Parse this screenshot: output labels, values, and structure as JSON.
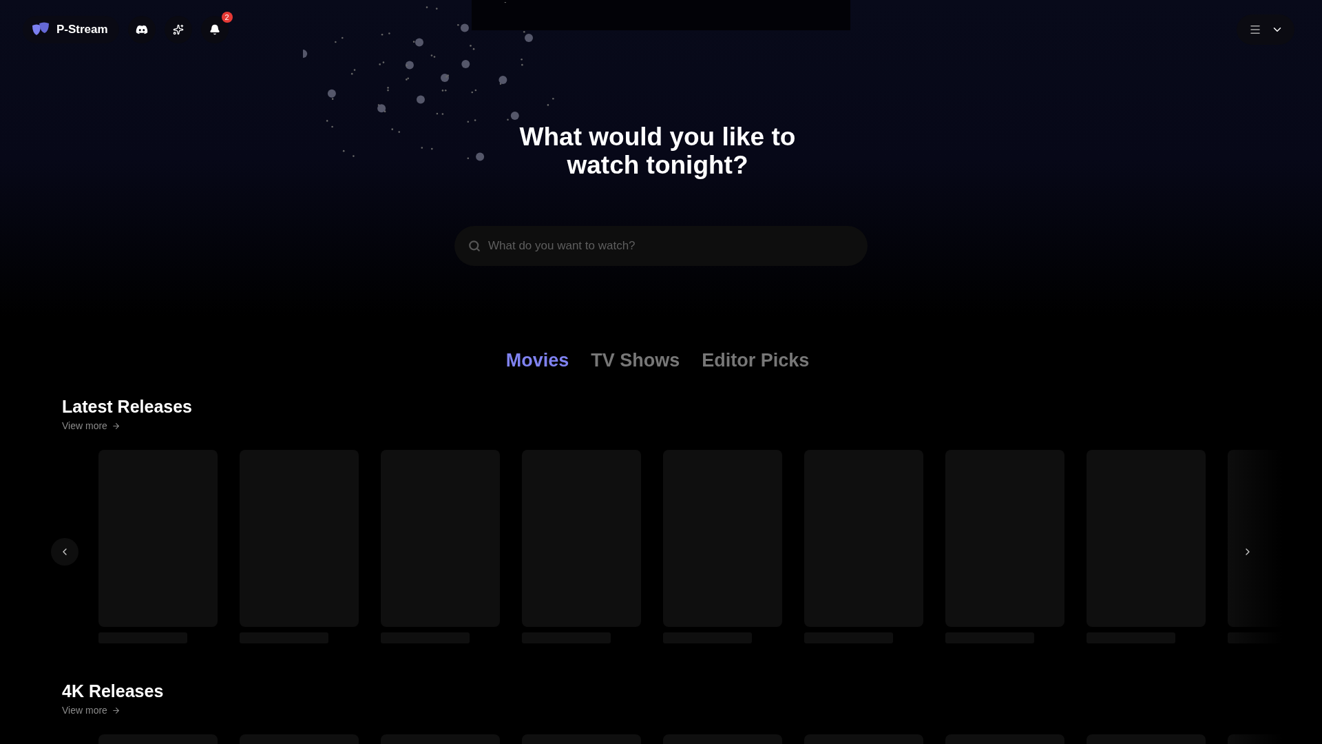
{
  "nav": {
    "brand": "P-Stream",
    "notifications_badge": "2"
  },
  "hero": {
    "title": "What would you like to watch tonight?",
    "search": {
      "placeholder": "What do you want to watch?"
    }
  },
  "tabs": [
    {
      "label": "Movies",
      "selected": true
    },
    {
      "label": "TV Shows",
      "selected": false
    },
    {
      "label": "Editor Picks",
      "selected": false
    }
  ],
  "sections": [
    {
      "title": "Latest Releases",
      "link": "View more"
    },
    {
      "title": "4K Releases",
      "link": "View more"
    }
  ]
}
